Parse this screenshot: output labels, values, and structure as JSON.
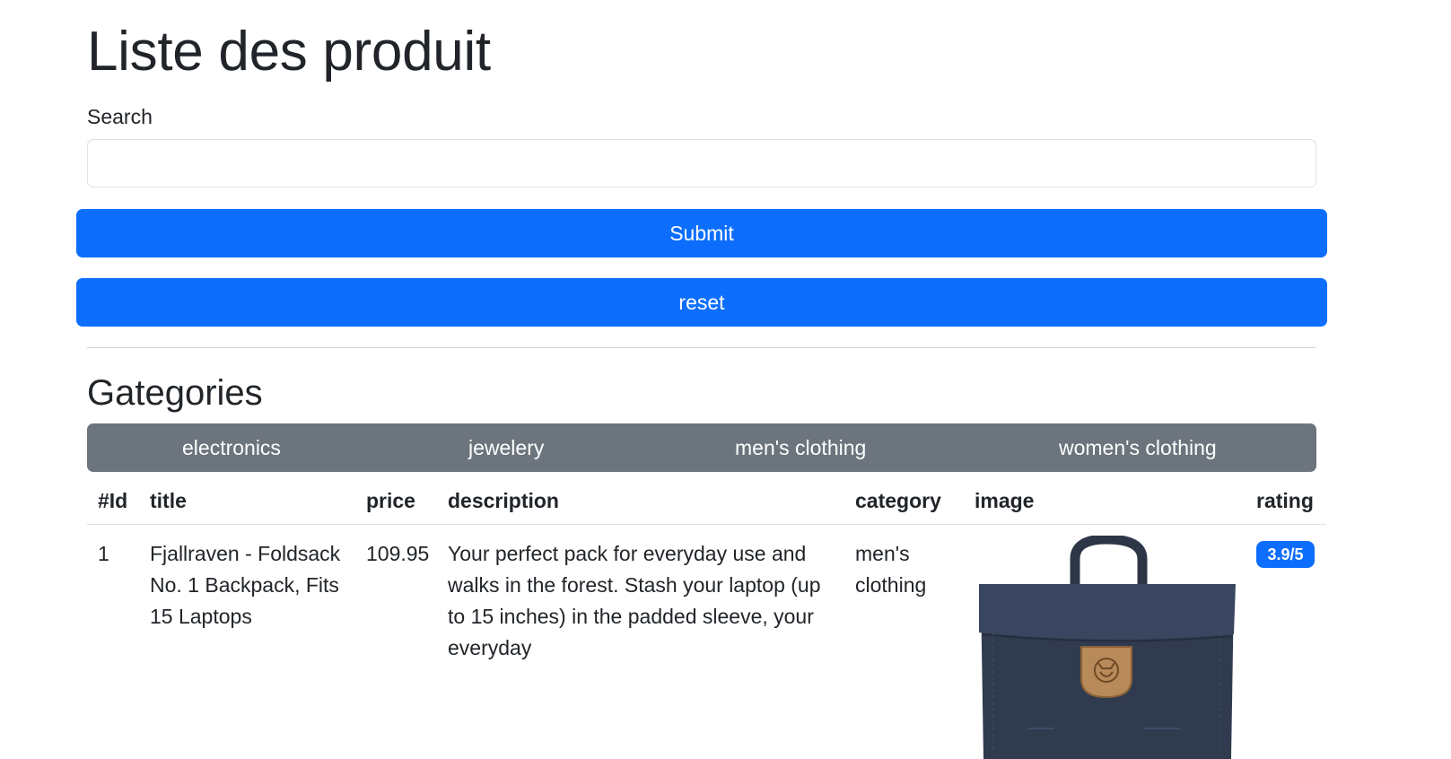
{
  "page": {
    "title": "Liste des produit"
  },
  "search": {
    "label": "Search",
    "value": "",
    "placeholder": ""
  },
  "buttons": {
    "submit": "Submit",
    "reset": "reset"
  },
  "categories": {
    "title": "Gategories",
    "items": [
      "electronics",
      "jewelery",
      "men's clothing",
      "women's clothing"
    ]
  },
  "table": {
    "headers": [
      "#Id",
      "title",
      "price",
      "description",
      "category",
      "image",
      "rating"
    ],
    "rows": [
      {
        "id": "1",
        "title_lines": [
          "Fjallraven - Foldsack",
          "No. 1 Backpack, Fits",
          "15 Laptops"
        ],
        "price": "109.95",
        "description_lines": [
          "Your perfect pack for everyday use and",
          "walks in the forest. Stash your laptop (up",
          "to 15 inches) in the padded sleeve, your",
          "everyday"
        ],
        "category_lines": [
          "men's",
          "clothing"
        ],
        "image": "navy-backpack-image",
        "rating": "3.9/5"
      }
    ]
  },
  "colors": {
    "primary": "#0d6efd",
    "secondary": "#6c757d",
    "text": "#212529",
    "border": "#dee2e6"
  }
}
